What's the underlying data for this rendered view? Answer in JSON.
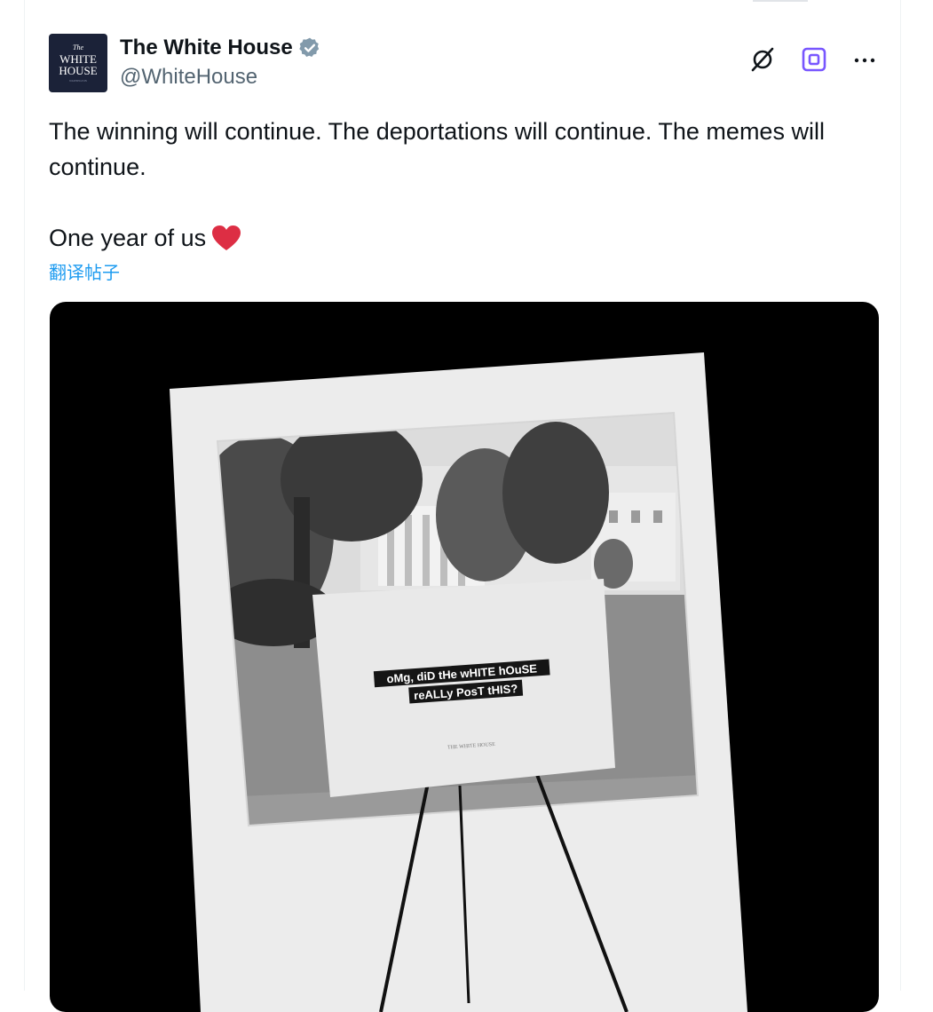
{
  "account": {
    "avatar_lines": [
      "The",
      "WHITE",
      "HOUSE",
      "WASHINGTON"
    ],
    "display_name": "The White House",
    "handle": "@WhiteHouse",
    "verified": true,
    "verified_color": "#829aab"
  },
  "actions": {
    "grok_icon": "grok-icon",
    "instagram_icon": "instagram-icon",
    "more_icon": "more-icon",
    "accent_color": "#7856ff"
  },
  "post": {
    "line1": "The winning will continue. The deportations will continue. The memes will continue.",
    "line2": "One year of us",
    "emoji": "heart",
    "translate": "翻译帖子",
    "link_color": "#1d9bf0"
  },
  "media": {
    "sign_line1": "oMg, diD tHe wHITE hOuSE",
    "sign_line2": "reALLy PosT tHIS?",
    "sign_footer": "THE WHITE HOUSE"
  }
}
